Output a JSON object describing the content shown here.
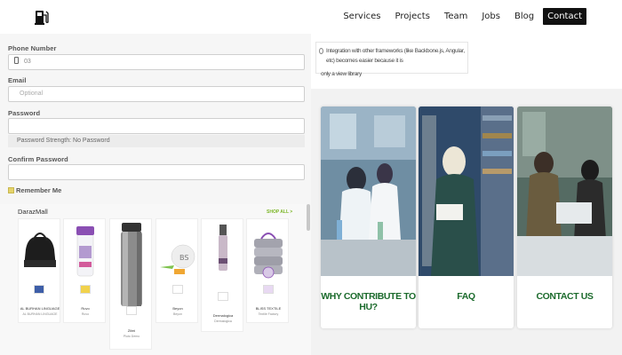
{
  "nav": {
    "logo_icon": "fuel-pump-icon",
    "links": [
      {
        "label": "Services"
      },
      {
        "label": "Projects"
      },
      {
        "label": "Team"
      },
      {
        "label": "Jobs"
      },
      {
        "label": "Blog"
      },
      {
        "label": "Contact",
        "active": true
      }
    ]
  },
  "form": {
    "phone_label": "Phone Number",
    "phone_value": "03",
    "email_label": "Email",
    "email_placeholder": "Optional",
    "password_label": "Password",
    "password_value": "",
    "strength_text": "Password Strength: No Password",
    "confirm_label": "Confirm Password",
    "confirm_value": "",
    "remember_label": "Remember Me"
  },
  "daraz": {
    "title": "DarazMall",
    "shop_all": "SHOP ALL >",
    "products": [
      {
        "name": "AL BURHAN LINGUAGE",
        "sub": "AL BURHAN LINGUAGE"
      },
      {
        "name": "Ruvo",
        "sub": "Ruvo"
      },
      {
        "name": "Zilmi",
        "sub": "Pluto Demo"
      },
      {
        "name": "Beyon",
        "sub": "Beyon"
      },
      {
        "name": "Dermalogica",
        "sub": "Dermalogica"
      },
      {
        "name": "BLISS TEXTILE",
        "sub": "Textile Factory"
      }
    ]
  },
  "note": {
    "text": "Integration with other frameworks (like Backbone.js, Angular, etc) becomes easier because it is",
    "tail": "only a view library"
  },
  "cards": [
    {
      "label": "WHY CONTRIBUTE TO HU?"
    },
    {
      "label": "FAQ"
    },
    {
      "label": "CONTACT US"
    }
  ],
  "colors": {
    "accent_green": "#1c6b2d",
    "nav_active_bg": "#111111",
    "shop_all_green": "#7bb526",
    "checkbox_yellow": "#e5d36a"
  }
}
